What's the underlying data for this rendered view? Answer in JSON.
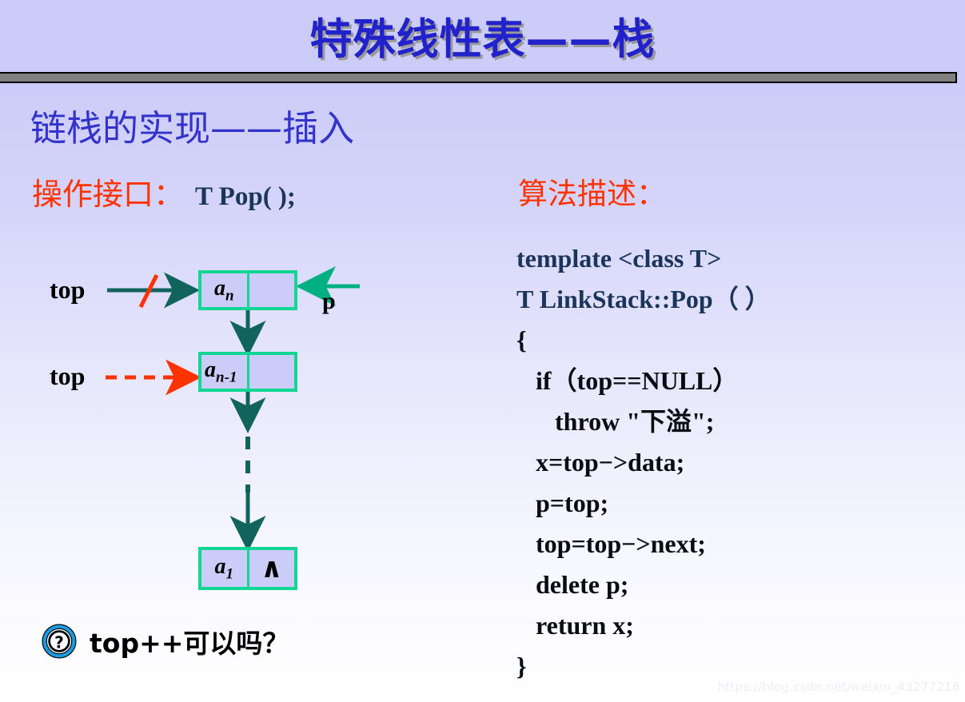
{
  "slide": {
    "title": "特殊线性表——栈",
    "subtitle": "链栈的实现——插入",
    "top_sliver_left": "…………",
    "top_sliver_right": "…………",
    "watermark": "https://blog.csdn.net/weixin_43277216",
    "colors": {
      "background": "#ccccf8",
      "title_text": "#2222cc",
      "title_shadow": "#9a9a9a",
      "subtitle_text": "#3333cc",
      "divider_bar": "#808080",
      "accent_red": "#ff3300",
      "code_navy": "#1b3459",
      "node_border_green": "#12d693",
      "arrow_teal": "#10645c",
      "arrow_green": "#00b083",
      "question_blue": "#1a9ae0"
    }
  },
  "left": {
    "operation_label": "操作接口：",
    "operation_signature": "T Pop( );",
    "pointer_labels": {
      "top_struck": "top",
      "top_new": "top",
      "p": "p"
    },
    "nodes": [
      {
        "data": "a",
        "sub": "n",
        "next": ""
      },
      {
        "data": "a",
        "sub": "n-1",
        "next": ""
      },
      {
        "data": "a",
        "sub": "1",
        "next": "∧"
      }
    ],
    "question_icon": "question-circle-icon",
    "question_text": "top++可以吗？"
  },
  "right": {
    "algorithm_label": "算法描述：",
    "code_lines": [
      "template <class T>",
      "T LinkStack::Pop（ ）",
      "{",
      "   if（top==NULL）",
      "      throw \"下溢\";",
      "   x=top−>data;",
      "   p=top;",
      "   top=top−>next;",
      "   delete p;",
      "   return x;",
      "}"
    ]
  }
}
